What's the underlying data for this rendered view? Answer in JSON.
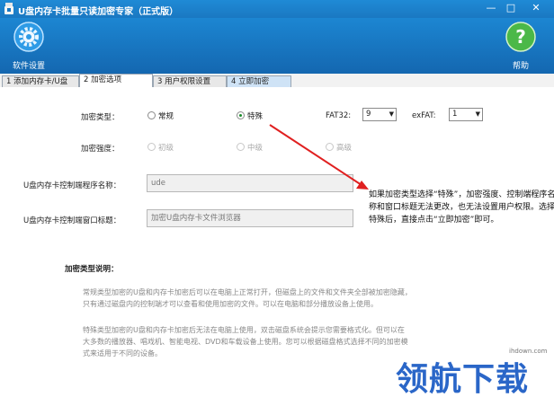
{
  "window": {
    "title": "U盘内存卡批量只读加密专家（正式版）",
    "min_label": "—",
    "max_label": "□",
    "close_label": "✕"
  },
  "toolbar": {
    "settings_label": "软件设置",
    "settings_icon": "gear-icon",
    "help_label": "帮助",
    "help_icon": "help-icon"
  },
  "tabs": [
    {
      "label": "1 添加内存卡/U盘"
    },
    {
      "label": "2 加密选项"
    },
    {
      "label": "3 用户权限设置"
    },
    {
      "label": "4 立即加密"
    }
  ],
  "active_tab": 1,
  "options": {
    "encrypt_type_label": "加密类型：",
    "type_normal": "常规",
    "type_special": "特殊",
    "selected_type": "特殊",
    "fat32_label": "FAT32:",
    "fat32_value": "9",
    "exfat_label": "exFAT:",
    "exfat_value": "1",
    "strength_label": "加密强度：",
    "strength_low": "初级",
    "strength_mid": "中级",
    "strength_high": "高级",
    "program_name_label": "U盘内存卡控制端程序名称：",
    "program_name_value": "ude",
    "window_title_label": "U盘内存卡控制端窗口标题：",
    "window_title_value": "加密U盘内存卡文件浏览器"
  },
  "description": {
    "title": "加密类型说明：",
    "normal_line1": "常规类型加密的U盘和内存卡加密后可以在电脑上正常打开，但磁盘上的文件和文件夹全部被加密隐藏，",
    "normal_line2": "只有通过磁盘内的控制端才可以查看和使用加密的文件。可以在电脑和部分播放设备上使用。",
    "special_line1": "特殊类型加密的U盘和内存卡加密后无法在电脑上使用，双击磁盘系统会提示您需要格式化。但可以在",
    "special_line2": "大多数的播放器、唱戏机、智能电视、DVD和车载设备上使用。您可以根据磁盘格式选择不同的加密模",
    "special_line3": "式来适用于不同的设备。"
  },
  "callout": {
    "text": "如果加密类型选择“特殊”，加密强度、控制端程序名称和窗口标题无法更改，也无法设置用户权限。选择特殊后，直接点击“立即加密”即可。"
  },
  "watermark": {
    "url": "ihdown.com",
    "text": "领航下载",
    "color": "#2a66c8"
  }
}
